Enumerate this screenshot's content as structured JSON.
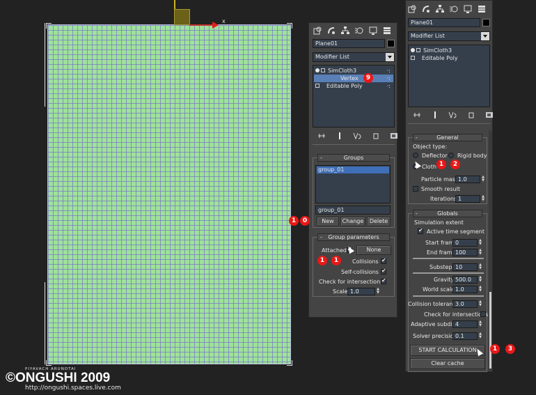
{
  "viewport": {
    "axis_label": "x"
  },
  "panel_left": {
    "object_name": "Plane01",
    "modifier_list": "Modifier List",
    "stack": [
      {
        "label": "SimCloth3",
        "selected": false
      },
      {
        "label": "Vertex",
        "selected": true
      },
      {
        "label": "Editable Poly",
        "selected": false
      }
    ],
    "groups": {
      "title": "Groups",
      "items": [
        "group_01"
      ],
      "name_value": "group_01",
      "buttons": {
        "new": "New",
        "change": "Change",
        "delete": "Delete"
      }
    },
    "group_params": {
      "title": "Group parameters",
      "attached": "Attached",
      "none": "None",
      "collisions": "Collisions",
      "self_collisions": "Self-collisions",
      "check_intersections": "Check for intersections",
      "scale_label": "Scale",
      "scale_value": "1.0"
    }
  },
  "panel_right": {
    "object_name": "Plane01",
    "modifier_list": "Modifier List",
    "stack": [
      {
        "label": "SimCloth3",
        "selected": false
      },
      {
        "label": "Editable Poly",
        "selected": false
      }
    ],
    "general": {
      "title": "General",
      "object_type": "Object type:",
      "deflector": "Deflector",
      "rigid_body": "Rigid body",
      "cloth": "Cloth",
      "particle_mass_label": "Particle mass",
      "particle_mass_value": "1.0",
      "smooth_result": "Smooth result",
      "iterations_label": "Iterations",
      "iterations_value": "1"
    },
    "globals": {
      "title": "Globals",
      "simulation_extent": "Simulation extent",
      "active_time_segment": "Active time segment",
      "start_frame_label": "Start frame",
      "start_frame_value": "0",
      "end_frame_label": "End frame",
      "end_frame_value": "100",
      "substeps_label": "Substeps",
      "substeps_value": "10",
      "gravity_label": "Gravity",
      "gravity_value": "500.0",
      "world_scale_label": "World scale",
      "world_scale_value": "1.0",
      "collision_tolerance_label": "Collision tolerance",
      "collision_tolerance_value": "3.0",
      "check_intersections": "Check for intersections",
      "adaptive_subdivs_label": "Adaptive subdivs",
      "adaptive_subdivs_value": "4",
      "solver_precision_label": "Solver precision",
      "solver_precision_value": "0.1",
      "start_calculation": "START CALCULATION",
      "clear_cache": "Clear cache"
    }
  },
  "annotations": {
    "step_9": "9",
    "step_10": [
      "1",
      "0"
    ],
    "step_11": [
      "1",
      "1"
    ],
    "step_12": [
      "1",
      "2"
    ],
    "step_13": [
      "1",
      "3"
    ],
    "badge_color": "#e81818"
  },
  "watermark": {
    "author": "PIYAVACH ARUNOTAI",
    "brand": "ONGUSHI 2009",
    "url": "http://ongushi.spaces.live.com"
  },
  "colors": {
    "plane": "#9fe29a",
    "selection": "#5a7fb6",
    "panel": "#444444"
  }
}
